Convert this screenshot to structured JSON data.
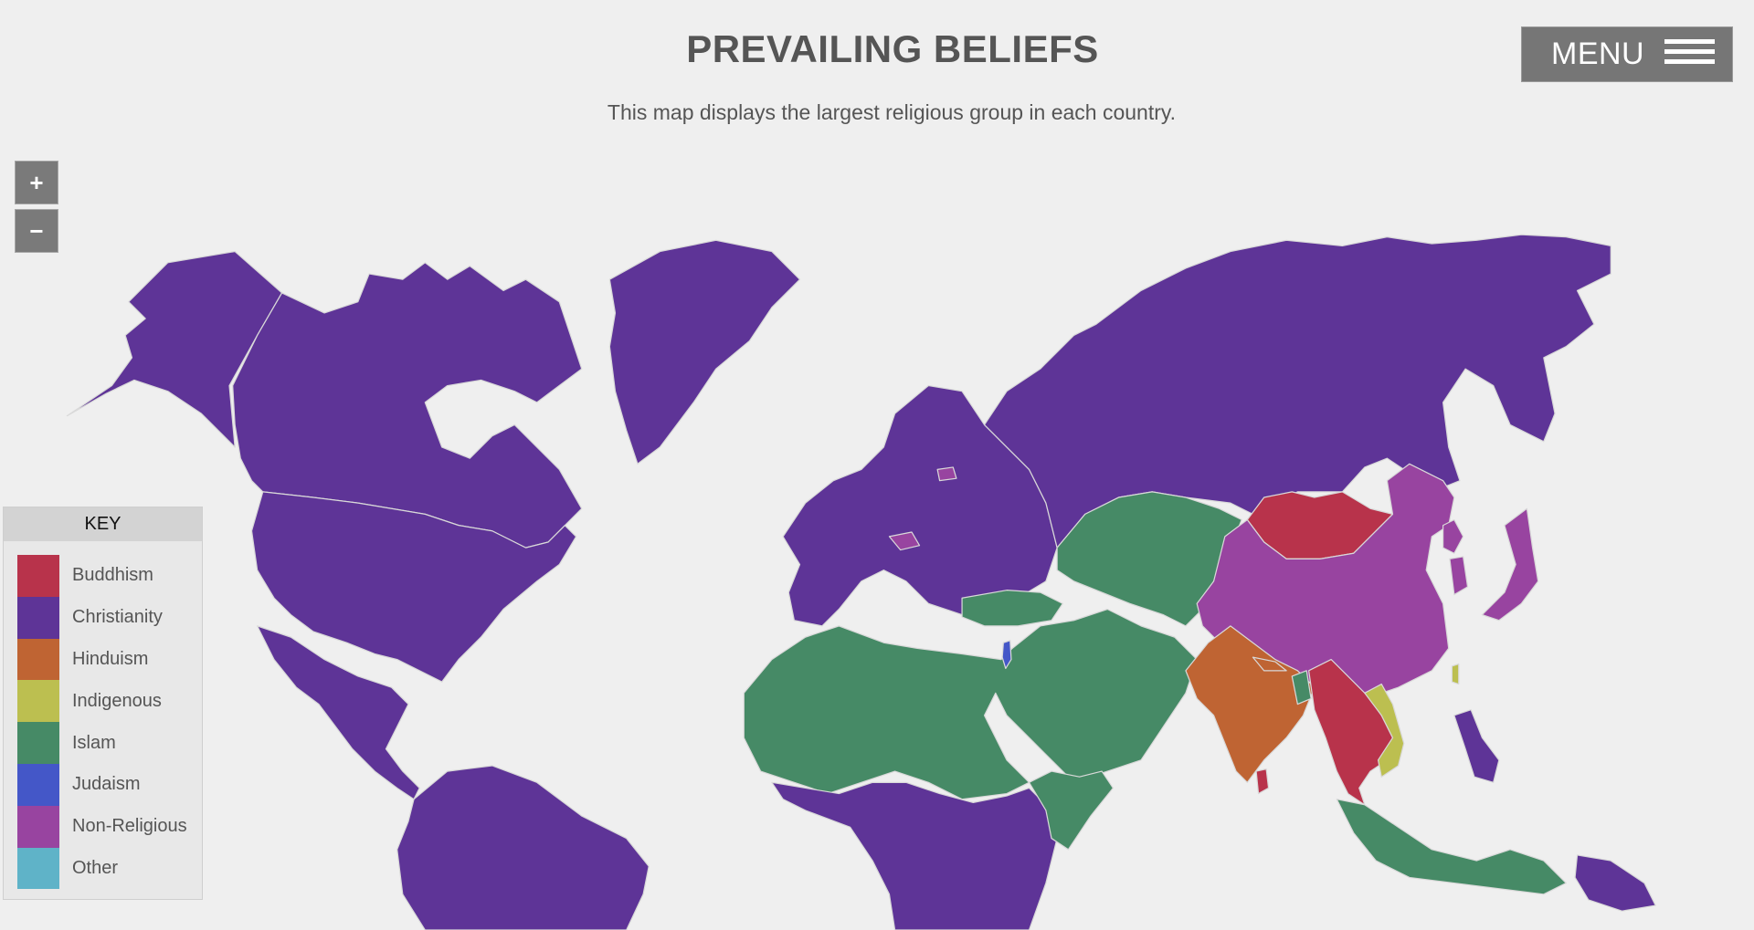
{
  "header": {
    "title": "PREVAILING BELIEFS",
    "subtitle": "This map displays the largest religious group in each country.",
    "menu_label": "MENU"
  },
  "zoom_controls": {
    "zoom_in": "+",
    "zoom_out": "−"
  },
  "legend": {
    "title": "KEY",
    "items": [
      {
        "label": "Buddhism",
        "color": "#b8334b"
      },
      {
        "label": "Christianity",
        "color": "#5e3497"
      },
      {
        "label": "Hinduism",
        "color": "#bf6433"
      },
      {
        "label": "Indigenous",
        "color": "#bcbf50"
      },
      {
        "label": "Islam",
        "color": "#468a66"
      },
      {
        "label": "Judaism",
        "color": "#4457c8"
      },
      {
        "label": "Non-Religious",
        "color": "#9844a0"
      },
      {
        "label": "Other",
        "color": "#5fb3c8"
      }
    ]
  },
  "map": {
    "background": "#efefef",
    "border_color": "#d9d9d9",
    "regions": [
      {
        "name": "Alaska / North America",
        "religion": "Christianity"
      },
      {
        "name": "Canada",
        "religion": "Christianity"
      },
      {
        "name": "Greenland",
        "religion": "Christianity"
      },
      {
        "name": "United States",
        "religion": "Christianity"
      },
      {
        "name": "Mexico & Central America",
        "religion": "Christianity"
      },
      {
        "name": "South America",
        "religion": "Christianity"
      },
      {
        "name": "Europe",
        "religion": "Christianity"
      },
      {
        "name": "Czech Republic",
        "religion": "Non-Religious"
      },
      {
        "name": "Estonia",
        "religion": "Non-Religious"
      },
      {
        "name": "Russia",
        "religion": "Christianity"
      },
      {
        "name": "North Africa & Middle East",
        "religion": "Islam"
      },
      {
        "name": "Turkey",
        "religion": "Islam"
      },
      {
        "name": "Israel",
        "religion": "Judaism"
      },
      {
        "name": "Central Asia",
        "religion": "Islam"
      },
      {
        "name": "Sub-Saharan Africa",
        "religion": "Christianity"
      },
      {
        "name": "Horn of Africa",
        "religion": "Islam"
      },
      {
        "name": "Mongolia",
        "religion": "Buddhism"
      },
      {
        "name": "China",
        "religion": "Non-Religious"
      },
      {
        "name": "North Korea",
        "religion": "Non-Religious"
      },
      {
        "name": "South Korea",
        "religion": "Non-Religious"
      },
      {
        "name": "Japan",
        "religion": "Non-Religious"
      },
      {
        "name": "India",
        "religion": "Hinduism"
      },
      {
        "name": "Nepal",
        "religion": "Hinduism"
      },
      {
        "name": "Bangladesh",
        "religion": "Islam"
      },
      {
        "name": "Myanmar / Thailand / Laos / Cambodia",
        "religion": "Buddhism"
      },
      {
        "name": "Sri Lanka",
        "religion": "Buddhism"
      },
      {
        "name": "Vietnam",
        "religion": "Indigenous"
      },
      {
        "name": "Taiwan",
        "religion": "Indigenous"
      },
      {
        "name": "Philippines",
        "religion": "Christianity"
      },
      {
        "name": "Indonesia / Malaysia",
        "religion": "Islam"
      },
      {
        "name": "Papua New Guinea",
        "religion": "Christianity"
      }
    ]
  }
}
